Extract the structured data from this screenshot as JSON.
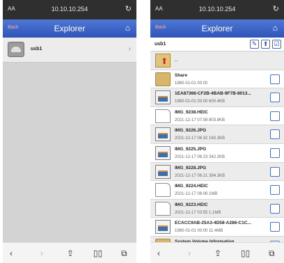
{
  "browser": {
    "aa": "AA",
    "url": "10.10.10.254",
    "reload": "↻"
  },
  "nav": {
    "back": "Back",
    "title": "Explorer",
    "home": "⌂"
  },
  "left": {
    "drive_label": "usb1",
    "chevron": "›"
  },
  "right": {
    "path": "usb1",
    "tools": {
      "wrench": "✎",
      "upload": "⬆",
      "edit": "☑"
    },
    "parent_label": "..",
    "files": [
      {
        "name": "Share",
        "meta": "1980-01-01 00:00",
        "icon": "folder"
      },
      {
        "name": "1EA87366-CF2B-4BAB-9F7B-8013...",
        "meta": "1980-01-01 00:00  600.4KB",
        "icon": "image"
      },
      {
        "name": "IMG_9238.HEIC",
        "meta": "2021-12-17 07:08  803.8KB",
        "icon": "doc"
      },
      {
        "name": "IMG_9226.JPG",
        "meta": "2021-12-17 06:32  160.3KB",
        "icon": "image"
      },
      {
        "name": "IMG_9225.JPG",
        "meta": "2021-12-17 06:23  342.2KB",
        "icon": "image"
      },
      {
        "name": "IMG_9228.JPG",
        "meta": "2021-12-17 06:21  394.3KB",
        "icon": "image"
      },
      {
        "name": "IMG_9224.HEIC",
        "meta": "2021-12-17 06:06  1MB",
        "icon": "doc"
      },
      {
        "name": "IMG_9223.HEIC",
        "meta": "2021-12-17 03:55  1.1MB",
        "icon": "doc"
      },
      {
        "name": "ECACC9AB-25A3-4D58-A286-C1C...",
        "meta": "1980-01-01 00:00  11.4MB",
        "icon": "image"
      },
      {
        "name": "System Volume Information",
        "meta": "",
        "icon": "folder"
      }
    ]
  },
  "toolbar": {
    "back": "‹",
    "forward": "›",
    "share": "⇪",
    "bookmarks": "▯▯",
    "tabs": "⧉"
  }
}
